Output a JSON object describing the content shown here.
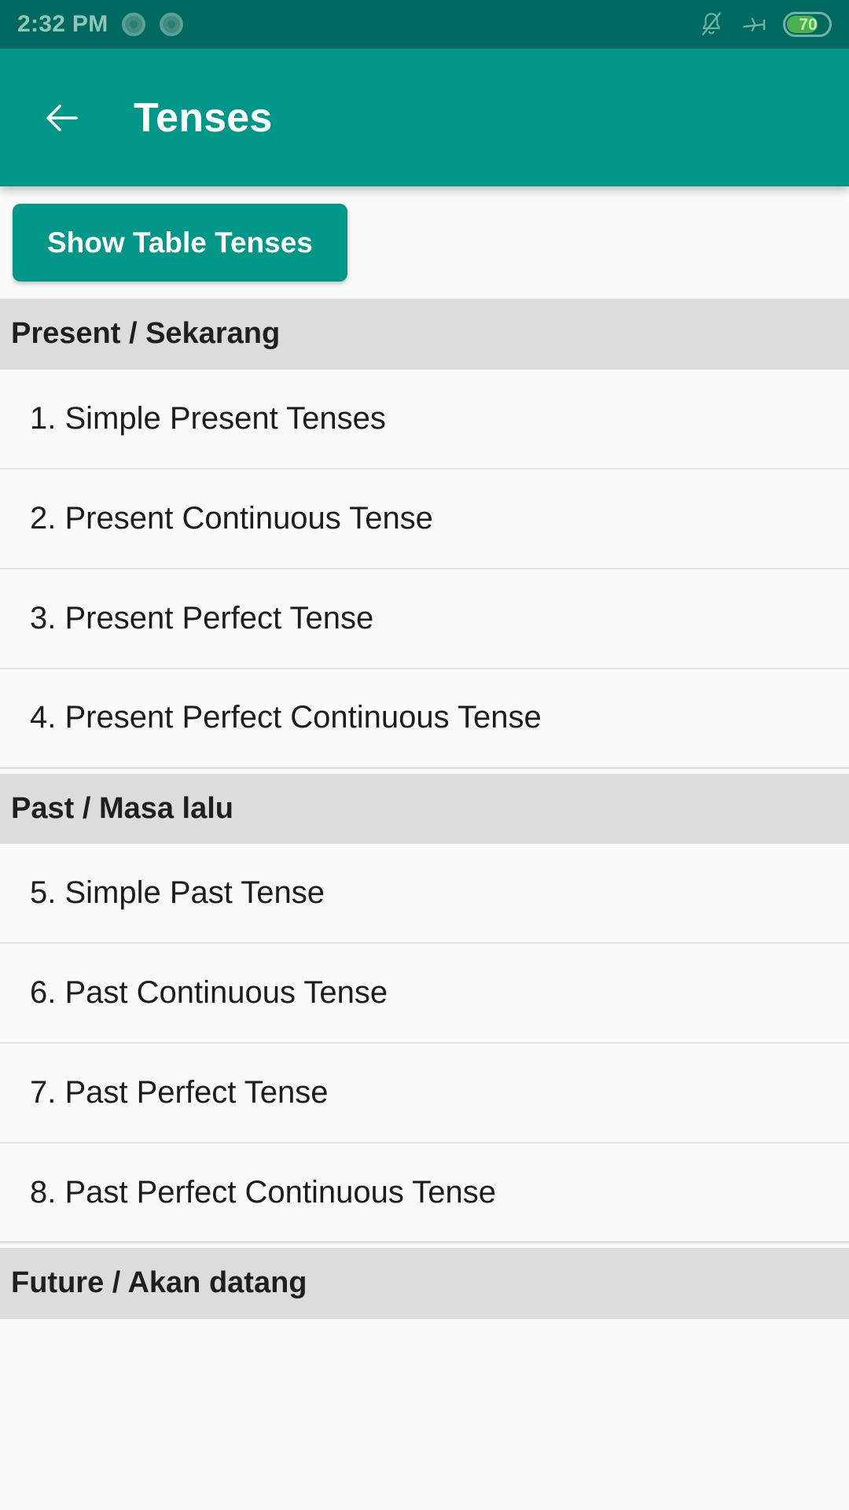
{
  "status_bar": {
    "time": "2:32 PM",
    "notification_dots": 2,
    "icons": [
      "bell-muted-icon",
      "airplane-mode-icon",
      "battery-icon"
    ],
    "battery_level": "70",
    "battery_percent": 70,
    "background_color": "#00695f",
    "text_color": "#8fc5bb"
  },
  "toolbar": {
    "back_icon": "back-arrow-icon",
    "title": "Tenses",
    "background_color": "#009688",
    "text_color": "#ffffff"
  },
  "actions": {
    "show_table_label": "Show Table Tenses",
    "button_color": "#009688"
  },
  "sections": [
    {
      "header": "Present / Sekarang",
      "items": [
        "1. Simple Present Tenses",
        "2. Present Continuous Tense",
        "3. Present Perfect Tense",
        "4. Present Perfect Continuous Tense"
      ]
    },
    {
      "header": "Past / Masa lalu",
      "items": [
        "5. Simple Past Tense",
        "6. Past Continuous Tense",
        "7. Past Perfect Tense",
        "8. Past Perfect Continuous Tense"
      ]
    },
    {
      "header": "Future / Akan datang",
      "items": []
    }
  ],
  "theme": {
    "page_background": "#fafafa",
    "section_header_background": "#dcdcdc",
    "divider_color": "#e4e4e4",
    "primary_text": "#1c1c1c"
  }
}
